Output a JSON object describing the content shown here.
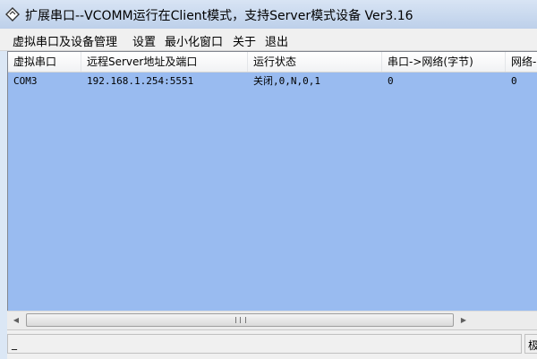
{
  "window": {
    "title": "扩展串口--VCOMM运行在Client模式，支持Server模式设备  Ver3.16"
  },
  "menu": {
    "items": [
      "虚拟串口及设备管理",
      "设置",
      "最小化窗口",
      "关于",
      "退出"
    ]
  },
  "table": {
    "columns": [
      "虚拟串口",
      "远程Server地址及端口",
      "运行状态",
      "串口->网络(字节)",
      "网络->"
    ],
    "rows": [
      [
        "COM3",
        "192.168.1.254:5551",
        "关闭,0,N,0,1",
        "0",
        "0"
      ]
    ]
  },
  "statusbar": {
    "left_text": "_",
    "right_text": "极"
  },
  "colors": {
    "list_background": "#99bbf0",
    "titlebar": "#c9daf0",
    "menubar": "#f0f0f0"
  },
  "icons": {
    "app": "app-diamond-icon",
    "scroll_left": "arrow-left-icon",
    "scroll_right": "arrow-right-icon"
  }
}
